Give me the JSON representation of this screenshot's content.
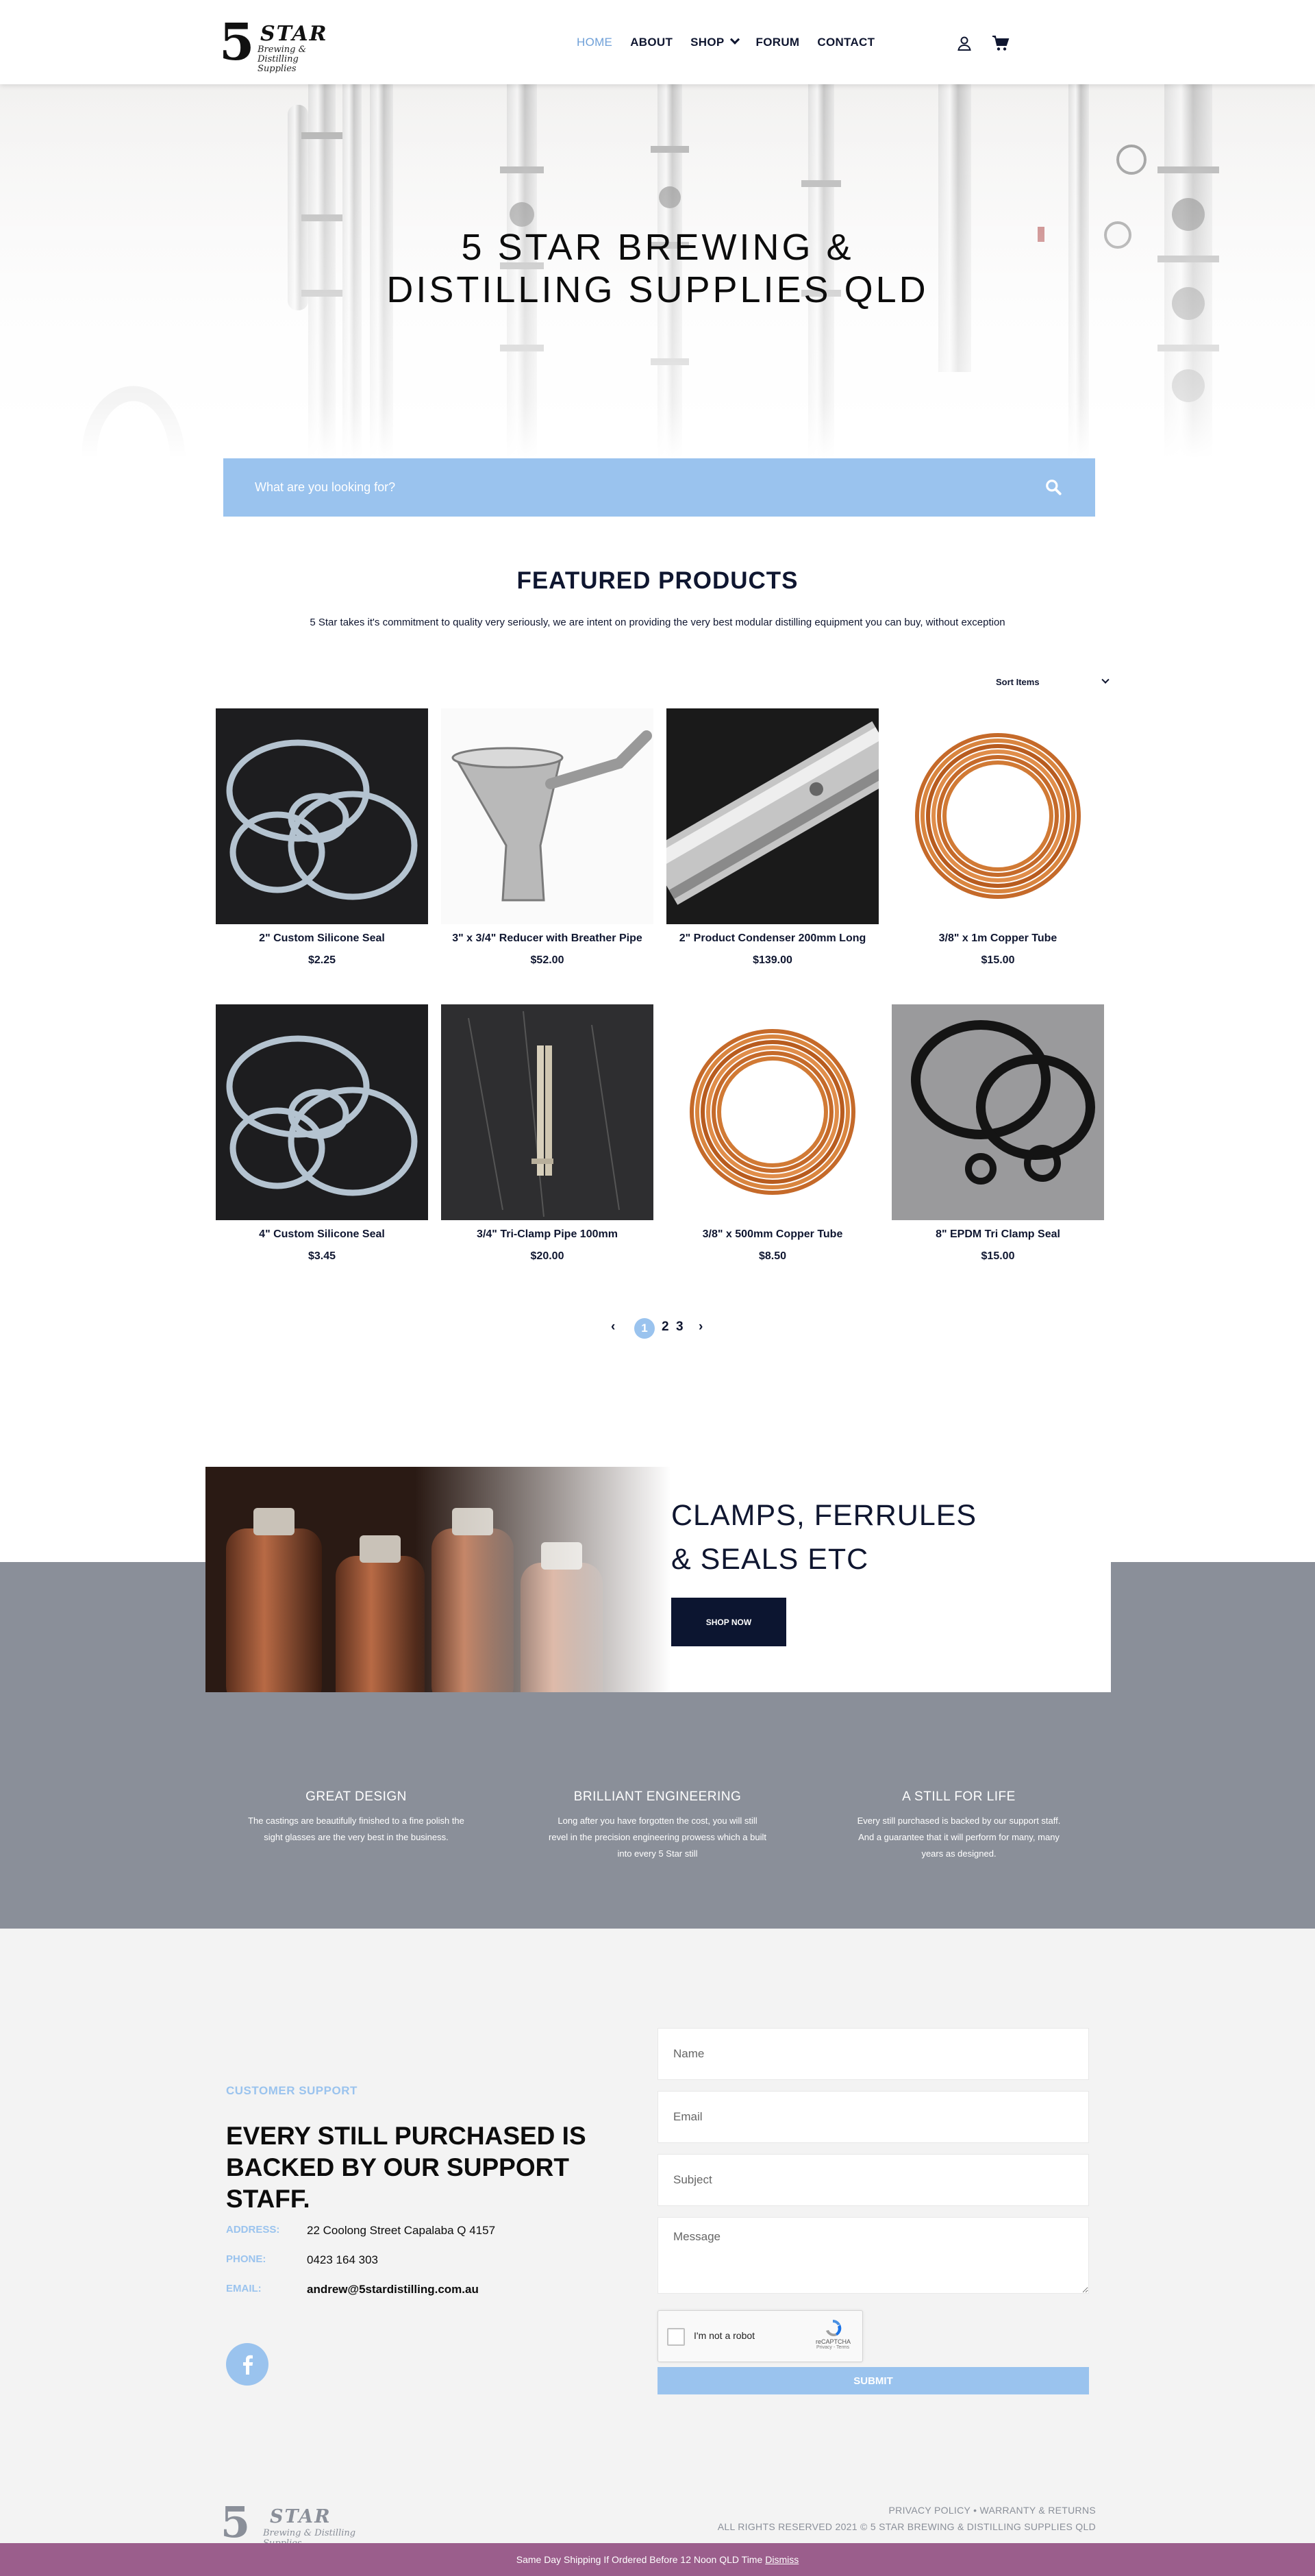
{
  "header": {
    "logo": {
      "number": "5",
      "word": "STAR",
      "tagline": "Brewing & Distilling Supplies"
    },
    "nav": [
      {
        "label": "HOME",
        "active": true
      },
      {
        "label": "ABOUT",
        "active": false
      },
      {
        "label": "SHOP",
        "active": false,
        "dropdown": true
      },
      {
        "label": "FORUM",
        "active": false
      },
      {
        "label": "CONTACT",
        "active": false
      }
    ],
    "icons": [
      "user-icon",
      "cart-icon"
    ]
  },
  "hero": {
    "title": "5 STAR BREWING & DISTILLING SUPPLIES QLD"
  },
  "search": {
    "placeholder": "What are you looking for?",
    "icon": "search-icon"
  },
  "featured": {
    "title": "FEATURED PRODUCTS",
    "subtitle": "5 Star takes it's commitment to quality very seriously, we are intent on providing the very best modular distilling equipment you can buy, without exception",
    "sort_label": "Sort Items",
    "products": [
      {
        "name": "2\" Custom Silicone Seal",
        "price": "$2.25"
      },
      {
        "name": "3\" x 3/4\" Reducer with Breather Pipe",
        "price": "$52.00"
      },
      {
        "name": "2\" Product Condenser 200mm Long",
        "price": "$139.00"
      },
      {
        "name": "3/8\" x 1m Copper Tube",
        "price": "$15.00"
      },
      {
        "name": "4\" Custom Silicone Seal",
        "price": "$3.45"
      },
      {
        "name": "3/4\" Tri-Clamp Pipe 100mm",
        "price": "$20.00"
      },
      {
        "name": "3/8\" x 500mm Copper Tube",
        "price": "$8.50"
      },
      {
        "name": "8\" EPDM Tri Clamp Seal",
        "price": "$15.00"
      }
    ],
    "pagination": {
      "pages": [
        "1",
        "2",
        "3"
      ],
      "current": "1"
    }
  },
  "promo": {
    "title_line1": "CLAMPS, FERRULES",
    "title_line2": "& SEALS ETC",
    "button": "SHOP NOW"
  },
  "features": [
    {
      "title": "GREAT DESIGN",
      "text": "The castings are beautifully finished to a fine polish the sight glasses are the very best in the business."
    },
    {
      "title": "BRILLIANT ENGINEERING",
      "text": "Long after you have forgotten the cost, you will still revel in the precision engineering prowess which a built into every 5 Star still"
    },
    {
      "title": "A STILL FOR LIFE",
      "text": "Every still purchased is backed by our support staff. And a guarantee that it will perform for many, many years as designed."
    }
  ],
  "contact": {
    "label": "CUSTOMER SUPPORT",
    "title": "EVERY STILL PURCHASED IS BACKED BY OUR SUPPORT STAFF.",
    "address_label": "ADDRESS:",
    "address": "22 Coolong Street Capalaba Q 4157",
    "phone_label": "PHONE:",
    "phone": "0423 164 303",
    "email_label": "EMAIL:",
    "email": "andrew@5stardistilling.com.au",
    "form": {
      "name_placeholder": "Name",
      "email_placeholder": "Email",
      "subject_placeholder": "Subject",
      "message_placeholder": "Message",
      "captcha_label": "I'm not a robot",
      "captcha_brand": "reCAPTCHA",
      "captcha_links": "Privacy - Terms",
      "submit": "SUBMIT"
    }
  },
  "footer": {
    "links": "PRIVACY POLICY • WARRANTY & RETURNS",
    "copyright": "ALL RIGHTS RESERVED 2021 © 5 STAR BREWING & DISTILLING SUPPLIES QLD"
  },
  "notice": {
    "text": "Same Day Shipping If Ordered Before 12 Noon QLD Time",
    "dismiss": "Dismiss",
    "color": "#9b5e8c"
  },
  "colors": {
    "accent": "#9ac3ee",
    "navy": "#0c1530",
    "grey_band": "#8a8f99"
  }
}
